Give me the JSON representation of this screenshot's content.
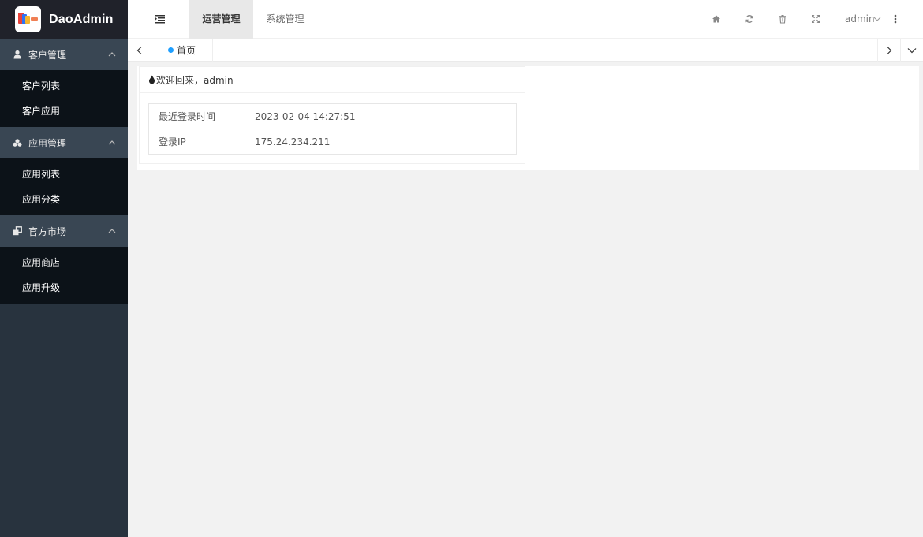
{
  "app": {
    "name": "DaoAdmin"
  },
  "sidebar": {
    "groups": [
      {
        "label": "客户管理",
        "icon": "user-icon",
        "items": [
          {
            "label": "客户列表"
          },
          {
            "label": "客户应用"
          }
        ]
      },
      {
        "label": "应用管理",
        "icon": "cubes-icon",
        "items": [
          {
            "label": "应用列表"
          },
          {
            "label": "应用分类"
          }
        ]
      },
      {
        "label": "官方市场",
        "icon": "clone-icon",
        "items": [
          {
            "label": "应用商店"
          },
          {
            "label": "应用升级"
          }
        ]
      }
    ]
  },
  "header": {
    "tabs": [
      {
        "label": "运营管理",
        "active": true
      },
      {
        "label": "系统管理",
        "active": false
      }
    ],
    "icons": [
      "home-icon",
      "refresh-icon",
      "trash-icon",
      "fullscreen-icon"
    ],
    "user": "admin"
  },
  "tabbar": {
    "current_tab": "首页"
  },
  "welcome": {
    "title": "欢迎回来，admin",
    "rows": [
      {
        "key": "最近登录时间",
        "value": "2023-02-04 14:27:51"
      },
      {
        "key": "登录IP",
        "value": "175.24.234.211"
      }
    ]
  },
  "colors": {
    "sidebar": "#28333e",
    "group_header": "#394653",
    "submenu": "#0c1218",
    "accent": "#1e9fff"
  }
}
